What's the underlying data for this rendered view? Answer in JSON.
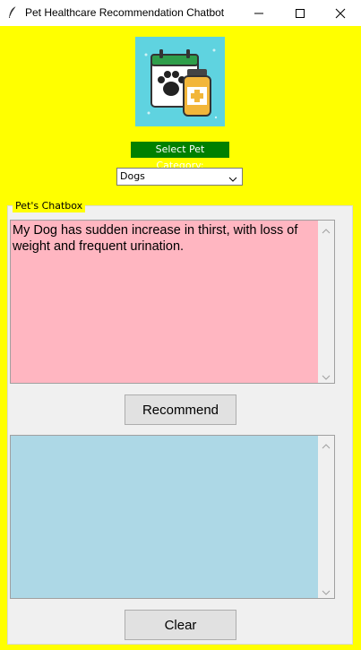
{
  "window": {
    "title": "Pet Healthcare Recommendation Chatbot",
    "app_icon": "feather-icon",
    "controls": [
      "minimize-icon",
      "maximize-icon",
      "close-icon"
    ]
  },
  "logo": {
    "icon": "pet-medicine-calendar-icon"
  },
  "category": {
    "label": "Select Pet Category:",
    "selected": "Dogs"
  },
  "chatbox": {
    "legend": "Pet's Chatbox",
    "input_text": "My Dog has sudden increase in thirst, with loss of weight and frequent urination.",
    "output_text": ""
  },
  "buttons": {
    "recommend": "Recommend",
    "clear": "Clear"
  },
  "colors": {
    "background": "#ffff00",
    "label_bg": "#008000",
    "input_bg": "#ffb6c1",
    "output_bg": "#add8e6"
  }
}
